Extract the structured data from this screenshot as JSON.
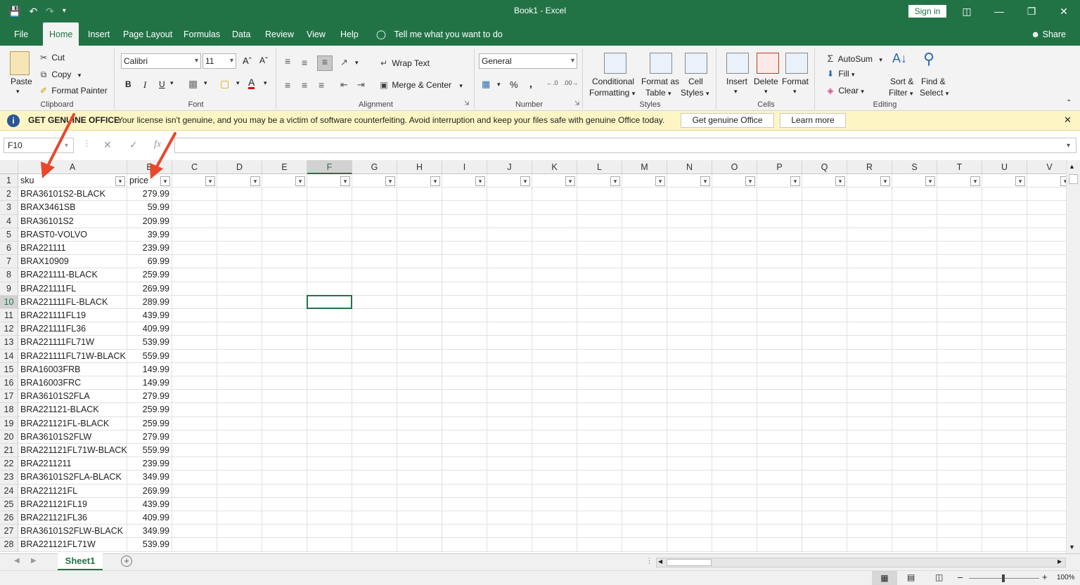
{
  "app": {
    "title": "Book1  -  Excel",
    "sign_in": "Sign in",
    "share": "Share",
    "tell_me": "Tell me what you want to do"
  },
  "tabs": [
    "File",
    "Home",
    "Insert",
    "Page Layout",
    "Formulas",
    "Data",
    "Review",
    "View",
    "Help"
  ],
  "ribbon": {
    "clipboard": {
      "label": "Clipboard",
      "paste": "Paste",
      "cut": "Cut",
      "copy": "Copy",
      "format_painter": "Format Painter"
    },
    "font": {
      "label": "Font",
      "name": "Calibri",
      "size": "11",
      "bold": "B",
      "italic": "I",
      "underline": "U"
    },
    "alignment": {
      "label": "Alignment",
      "wrap_text": "Wrap Text",
      "merge_center": "Merge & Center"
    },
    "number": {
      "label": "Number",
      "format": "General",
      "percent": "%",
      "comma": ","
    },
    "styles": {
      "label": "Styles",
      "conditional": "Conditional",
      "formatting": "Formatting",
      "format_as": "Format as",
      "table": "Table",
      "cell": "Cell",
      "cell_styles": "Styles"
    },
    "cells": {
      "label": "Cells",
      "insert": "Insert",
      "delete": "Delete",
      "format": "Format"
    },
    "editing": {
      "label": "Editing",
      "autosum": "AutoSum",
      "fill": "Fill",
      "clear": "Clear",
      "sort": "Sort &",
      "filter": "Filter",
      "find": "Find &",
      "select": "Select"
    }
  },
  "warning": {
    "heading": "GET GENUINE OFFICE",
    "message": "Your license isn't genuine, and you may be a victim of software counterfeiting. Avoid interruption and keep your files safe with genuine Office today.",
    "button_primary": "Get genuine Office",
    "button_secondary": "Learn more"
  },
  "formula_bar": {
    "name_box": "F10",
    "fx": "fx",
    "value": ""
  },
  "columns": [
    "A",
    "B",
    "C",
    "D",
    "E",
    "F",
    "G",
    "H",
    "I",
    "J",
    "K",
    "L",
    "M",
    "N",
    "O",
    "P",
    "Q",
    "R",
    "S",
    "T",
    "U",
    "V"
  ],
  "selected_cell": "F10",
  "headers": [
    "sku",
    "price"
  ],
  "rows": [
    [
      "BRA36101S2-BLACK",
      "279.99"
    ],
    [
      "BRAX3461SB",
      "59.99"
    ],
    [
      "BRA36101S2",
      "209.99"
    ],
    [
      "BRAST0-VOLVO",
      "39.99"
    ],
    [
      "BRA221111",
      "239.99"
    ],
    [
      "BRAX10909",
      "69.99"
    ],
    [
      "BRA221111-BLACK",
      "259.99"
    ],
    [
      "BRA221111FL",
      "269.99"
    ],
    [
      "BRA221111FL-BLACK",
      "289.99"
    ],
    [
      "BRA221111FL19",
      "439.99"
    ],
    [
      "BRA221111FL36",
      "409.99"
    ],
    [
      "BRA221111FL71W",
      "539.99"
    ],
    [
      "BRA221111FL71W-BLACK",
      "559.99"
    ],
    [
      "BRA16003FRB",
      "149.99"
    ],
    [
      "BRA16003FRC",
      "149.99"
    ],
    [
      "BRA36101S2FLA",
      "279.99"
    ],
    [
      "BRA221121-BLACK",
      "259.99"
    ],
    [
      "BRA221121FL-BLACK",
      "259.99"
    ],
    [
      "BRA36101S2FLW",
      "279.99"
    ],
    [
      "BRA221121FL71W-BLACK",
      "559.99"
    ],
    [
      "BRA2211211",
      "239.99"
    ],
    [
      "BRA36101S2FLA-BLACK",
      "349.99"
    ],
    [
      "BRA221121FL",
      "269.99"
    ],
    [
      "BRA221121FL19",
      "439.99"
    ],
    [
      "BRA221121FL36",
      "409.99"
    ],
    [
      "BRA36101S2FLW-BLACK",
      "349.99"
    ],
    [
      "BRA221121FL71W",
      "539.99"
    ]
  ],
  "sheet_tab": "Sheet1",
  "zoom": "100%",
  "colors": {
    "accent": "#217346",
    "arrow": "#e8472c",
    "warning_bg": "#fdf6c4"
  }
}
